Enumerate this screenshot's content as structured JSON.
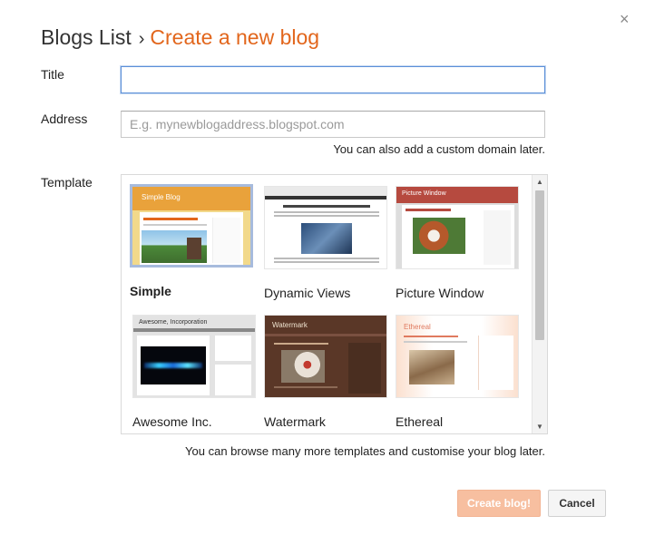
{
  "header": {
    "breadcrumb_root": "Blogs List",
    "separator": "›",
    "current": "Create a new blog"
  },
  "form": {
    "title_label": "Title",
    "title_value": "",
    "address_label": "Address",
    "address_placeholder": "E.g. mynewblogaddress.blogspot.com",
    "address_value": "",
    "address_hint": "You can also add a custom domain later.",
    "template_label": "Template",
    "templates_hint": "You can browse many more templates and customise your blog later."
  },
  "templates": [
    {
      "name": "Simple",
      "selected": true,
      "thumb_title": "Simple Blog"
    },
    {
      "name": "Dynamic Views",
      "selected": false
    },
    {
      "name": "Picture Window",
      "selected": false,
      "thumb_title": "Picture Window"
    },
    {
      "name": "Awesome Inc.",
      "selected": false,
      "thumb_title": "Awesome, Incorporation"
    },
    {
      "name": "Watermark",
      "selected": false,
      "thumb_title": "Watermark"
    },
    {
      "name": "Ethereal",
      "selected": false,
      "thumb_title": "Ethereal"
    }
  ],
  "buttons": {
    "create": "Create blog!",
    "cancel": "Cancel",
    "close": "×"
  },
  "colors": {
    "accent": "#e2661c",
    "create_button": "#f7bfa0",
    "focus_border": "#5b8fd8",
    "selected_template_border": "#a7bbdd"
  }
}
